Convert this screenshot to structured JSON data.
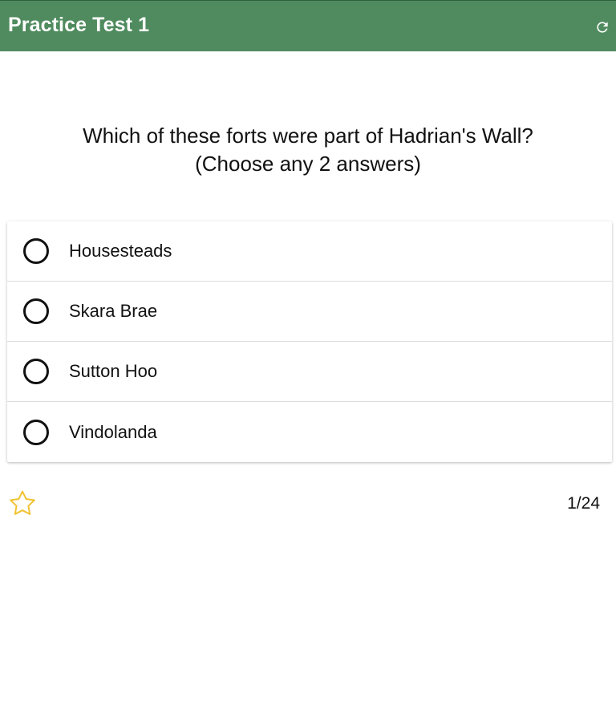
{
  "header": {
    "title": "Practice Test 1",
    "background_color": "#4f8b5e",
    "refresh_icon": "refresh-icon"
  },
  "question": {
    "line1": "Which of these forts were part of Hadrian's Wall?",
    "line2": "(Choose any 2 answers)"
  },
  "answers": [
    {
      "label": "Housesteads",
      "selected": false
    },
    {
      "label": "Skara Brae",
      "selected": false
    },
    {
      "label": "Sutton Hoo",
      "selected": false
    },
    {
      "label": "Vindolanda",
      "selected": false
    }
  ],
  "footer": {
    "star_icon": "star-outline-icon",
    "star_color": "#f1c232",
    "progress": "1/24"
  }
}
